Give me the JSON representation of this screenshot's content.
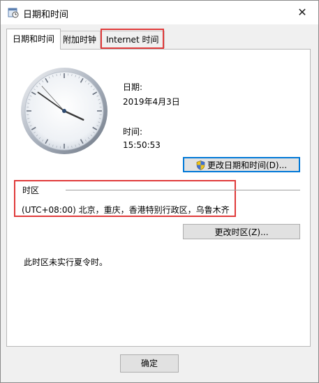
{
  "window": {
    "title": "日期和时间",
    "close_symbol": "✕"
  },
  "tabs": [
    {
      "label": "日期和时间",
      "active": true
    },
    {
      "label": "附加时钟",
      "active": false
    },
    {
      "label": "Internet 时间",
      "active": false,
      "highlighted": true
    }
  ],
  "datetime": {
    "date_label": "日期:",
    "date_value": "2019年4月3日",
    "time_label": "时间:",
    "time_value": "15:50:53",
    "change_button": "更改日期和时间(D)..."
  },
  "timezone": {
    "section_label": "时区",
    "value": "(UTC+08:00) 北京，重庆，香港特别行政区，乌鲁木齐",
    "change_button": "更改时区(Z)...",
    "dst_note": "此时区未实行夏令时。"
  },
  "footer": {
    "ok_button": "确定"
  },
  "clock": {
    "hours": 15,
    "minutes": 50,
    "seconds": 53
  },
  "colors": {
    "highlight": "#e03a3a",
    "accent": "#0078d7",
    "button_bg": "#e1e1e1"
  }
}
